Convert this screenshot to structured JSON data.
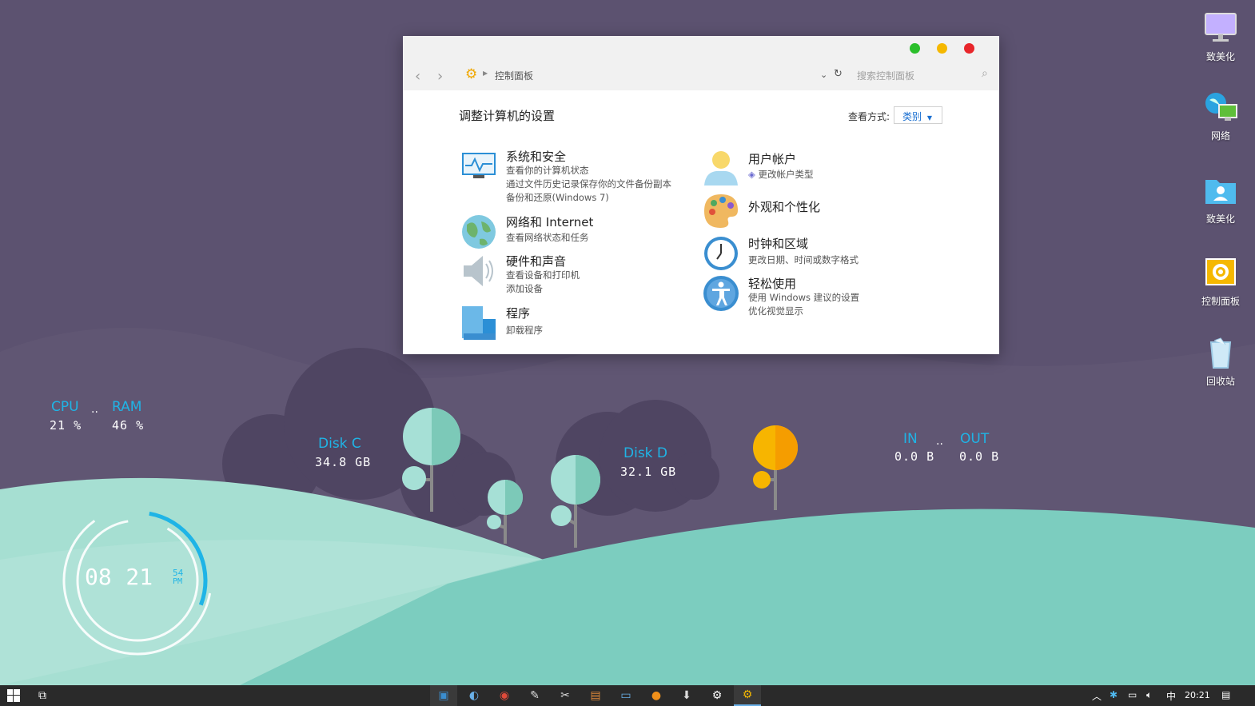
{
  "desktop": {
    "icons": [
      {
        "label": "致美化",
        "icon": "monitor-icon"
      },
      {
        "label": "网络",
        "icon": "network-icon"
      },
      {
        "label": "致美化",
        "icon": "user-folder-icon"
      },
      {
        "label": "控制面板",
        "icon": "control-panel-icon"
      },
      {
        "label": "回收站",
        "icon": "recycle-bin-icon"
      }
    ]
  },
  "widgets": {
    "cpu": {
      "title": "CPU",
      "value": "21 %"
    },
    "ram": {
      "title": "RAM",
      "value": "46 %"
    },
    "disk_c": {
      "title": "Disk C",
      "value": "34.8 GB"
    },
    "disk_d": {
      "title": "Disk D",
      "value": "32.1 GB"
    },
    "net_in": {
      "title": "IN",
      "value": "0.0 B"
    },
    "net_out": {
      "title": "OUT",
      "value": "0.0 B"
    },
    "clock": {
      "hour": "08",
      "minute": "21",
      "second": "54",
      "ampm": "PM"
    },
    "separator": ".."
  },
  "control_panel": {
    "breadcrumb": "控制面板",
    "search_placeholder": "搜索控制面板",
    "heading": "调整计算机的设置",
    "view_by_label": "查看方式:",
    "view_by_value": "类别",
    "left_categories": [
      {
        "title": "系统和安全",
        "icon": "system-security-icon",
        "links": [
          "查看你的计算机状态",
          "通过文件历史记录保存你的文件备份副本",
          "备份和还原(Windows 7)"
        ]
      },
      {
        "title": "网络和 Internet",
        "icon": "globe-icon",
        "links": [
          "查看网络状态和任务"
        ]
      },
      {
        "title": "硬件和声音",
        "icon": "speaker-icon",
        "links": [
          "查看设备和打印机",
          "添加设备"
        ]
      },
      {
        "title": "程序",
        "icon": "programs-icon",
        "links": [
          "卸载程序"
        ]
      }
    ],
    "right_categories": [
      {
        "title": "用户帐户",
        "icon": "user-icon",
        "links": [
          "更改帐户类型"
        ]
      },
      {
        "title": "外观和个性化",
        "icon": "palette-icon",
        "links": []
      },
      {
        "title": "时钟和区域",
        "icon": "clock-icon",
        "links": [
          "更改日期、时间或数字格式"
        ]
      },
      {
        "title": "轻松使用",
        "icon": "accessibility-icon",
        "links": [
          "使用 Windows 建议的设置",
          "优化视觉显示"
        ]
      }
    ],
    "colors": {
      "maximize": "#2bbf2b",
      "minimize": "#f5b800",
      "close": "#e8262b"
    }
  },
  "taskbar": {
    "apps": [
      "explorer-icon",
      "edge-icon",
      "chrome-icon",
      "notes-icon",
      "tools-icon",
      "gallery-icon",
      "display-icon",
      "firefox-icon",
      "download-icon",
      "settings-icon",
      "control-panel-icon"
    ],
    "ime": "中",
    "time": "20:21"
  },
  "colors": {
    "desktop": "#5c5270",
    "accent": "#1fb4e6",
    "hill": "#7ccdbf",
    "taskbar": "#2a2a2a"
  }
}
